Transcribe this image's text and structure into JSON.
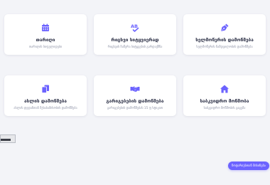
{
  "accent_color": "#6c63ff",
  "cards": [
    {
      "icon": "calendar-icon",
      "title": "თარიღი",
      "description": "თარიღის სიფელიდები"
    },
    {
      "icon": "spell-check-icon",
      "title": "რიცხვი სიტყვიერად",
      "description": "რიცხვის ჩაწერა სიტყვების გარდაქმნა"
    },
    {
      "icon": "pen-nib-icon",
      "title": "ხელმოწერის დამოწმება",
      "description": "ხელმოწერის ნამდვილობის დამოწმება"
    },
    {
      "icon": "copy-icon",
      "title": "ასლის დამოწმება",
      "description": "ასლის დედანთან შესაბამისობის დამოწმება"
    },
    {
      "icon": "handshake-icon",
      "title": "გარიგებების დამოწმება",
      "description": "გარიგებების დამოწმებას 15 ფ სტიკით"
    },
    {
      "icon": "home-icon",
      "title": "საბკვიდრო მოწმობა",
      "description": "საბკვიდრო მოწმობის გაცემა"
    }
  ],
  "fab": {
    "label": "ნოტარიუსთან მისინება"
  }
}
